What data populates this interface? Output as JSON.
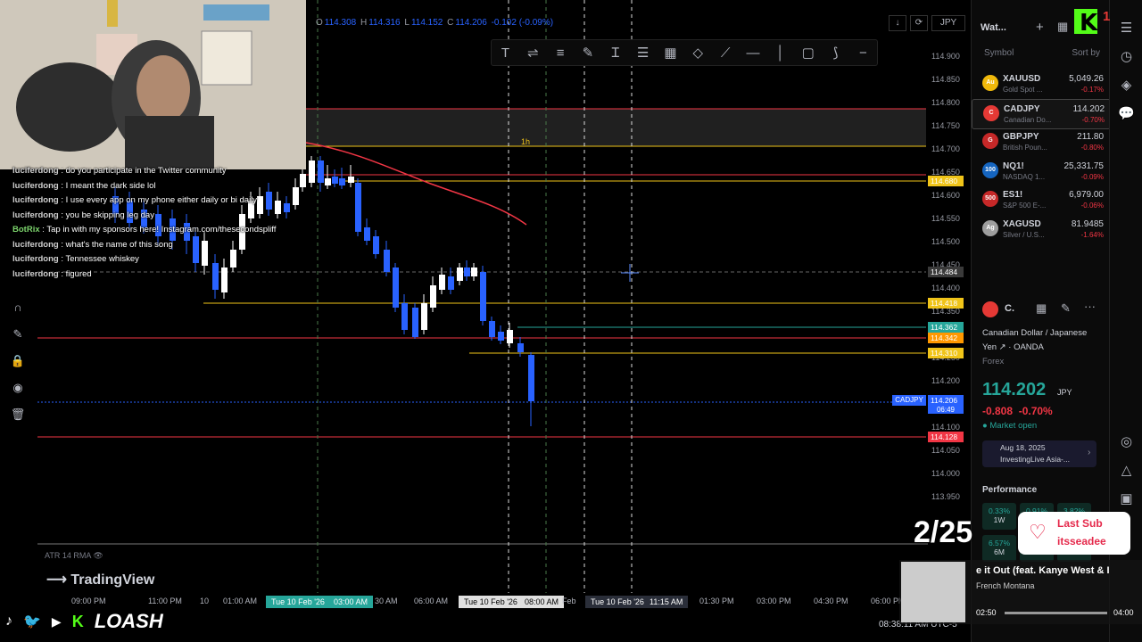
{
  "chart": {
    "ohlc": {
      "open_label": "O",
      "open": "114.308",
      "high_label": "H",
      "high": "114.316",
      "low_label": "L",
      "low": "114.152",
      "close_label": "C",
      "close": "114.206",
      "change": "-0.102 (-0.09%)"
    },
    "currency": "JPY",
    "interval_label": "1h",
    "indicator": "ATR 14 RMA",
    "watermark": "TradingView",
    "symbol_tag": "CADJPY",
    "countdown": "06:49",
    "price_axis": [
      "114.900",
      "114.850",
      "114.800",
      "114.750",
      "114.700",
      "114.650",
      "114.600",
      "114.550",
      "114.500",
      "114.450",
      "114.400",
      "114.350",
      "114.300",
      "114.250",
      "114.200",
      "114.150",
      "114.100",
      "114.050",
      "114.000",
      "113.950"
    ],
    "price_tags": [
      {
        "value": "114.680",
        "color": "#f0c419"
      },
      {
        "value": "114.484",
        "color": "#3a3a3a"
      },
      {
        "value": "114.418",
        "color": "#f0c419"
      },
      {
        "value": "114.362",
        "color": "#26a69a"
      },
      {
        "value": "114.342",
        "color": "#ff9800"
      },
      {
        "value": "114.310",
        "color": "#f0c419"
      },
      {
        "value": "114.206",
        "color": "#2962ff"
      },
      {
        "value": "114.128",
        "color": "#f23645"
      }
    ],
    "time_axis": [
      "09:00 PM",
      "11:00 PM",
      "10",
      "01:00 AM",
      "Tue 10 Feb '26",
      "03:00 AM",
      "30 AM",
      "06:00 AM",
      "Tue 10 Feb '26",
      "08:00 AM",
      "Feb",
      "Tue 10 Feb '26",
      "11:15 AM",
      "01:30 PM",
      "03:00 PM",
      "04:30 PM",
      "06:00 PM"
    ],
    "clock": "08:38:11 AM UTC-5",
    "toolbar_icons": [
      "text-icon",
      "align-icon",
      "align2-icon",
      "pen-icon",
      "text-cursor-icon",
      "lines-icon",
      "grid-icon",
      "shape-icon",
      "ray-icon",
      "horizontal-line-icon",
      "vertical-line-icon",
      "rect-icon",
      "brush-icon",
      "minus-icon"
    ]
  },
  "chat": [
    {
      "user": "luciferdong",
      "msg": "do you participate in the Twitter community"
    },
    {
      "user": "luciferdong",
      "msg": "I meant the dark side lol"
    },
    {
      "user": "luciferdong",
      "msg": "I use every app on my phone either daily or bi daily"
    },
    {
      "user": "luciferdong",
      "msg": "you be skipping leg day"
    },
    {
      "user": "BotRix",
      "msg": "Tap in with my sponsors here! Instagram.com/thesecondspliff",
      "bot": true
    },
    {
      "user": "luciferdong",
      "msg": "what's the name of this song"
    },
    {
      "user": "luciferdong",
      "msg": "Tennessee whiskey"
    },
    {
      "user": "luciferdong",
      "msg": "figured"
    }
  ],
  "watchlist": {
    "title": "Wat...",
    "col_symbol": "Symbol",
    "col_sort": "Sort by",
    "items": [
      {
        "sym": "XAUUSD",
        "desc": "Gold Spot ...",
        "price": "5,049.26",
        "chg": "-0.17%",
        "icon_color": "#f0b90b",
        "icon": "Au"
      },
      {
        "sym": "CADJPY",
        "desc": "Canadian Do...",
        "price": "114.202",
        "chg": "-0.70%",
        "icon_color": "#e53935",
        "icon": "C",
        "selected": true
      },
      {
        "sym": "GBPJPY",
        "desc": "British Poun...",
        "price": "211.80",
        "chg": "-0.80%",
        "icon_color": "#c62828",
        "icon": "G"
      },
      {
        "sym": "NQ1!",
        "desc": "NASDAQ 1...",
        "price": "25,331.75",
        "chg": "-0.09%",
        "icon_color": "#1565c0",
        "icon": "100"
      },
      {
        "sym": "ES1!",
        "desc": "S&P 500 E-...",
        "price": "6,979.00",
        "chg": "-0.06%",
        "icon_color": "#c62828",
        "icon": "500"
      },
      {
        "sym": "XAGUSD",
        "desc": "Silver / U.S...",
        "price": "81.9485",
        "chg": "-1.64%",
        "icon_color": "#9e9e9e",
        "icon": "Ag"
      }
    ]
  },
  "detail": {
    "short": "C.",
    "name": "Canadian Dollar / Japanese Yen",
    "broker": "OANDA",
    "type": "Forex",
    "price": "114.202",
    "ccy": "JPY",
    "change": "-0.808",
    "change_pct": "-0.70%",
    "status": "Market open",
    "news_date": "Aug 18, 2025",
    "news_src": "InvestingLive Asia-...",
    "perf_title": "Performance",
    "perf": [
      {
        "v": "0.33%",
        "p": "1W"
      },
      {
        "v": "0.91%",
        "p": ""
      },
      {
        "v": "3.82%",
        "p": ""
      },
      {
        "v": "6.57%",
        "p": "6M"
      },
      {
        "v": "",
        "p": "YTD"
      },
      {
        "v": "",
        "p": ""
      }
    ]
  },
  "overlay": {
    "sub_count": "2/25",
    "sub_label1": "Last Sub",
    "sub_label2": "itsseadee",
    "song_title": "e it Out (feat. Kanye West & I",
    "song_artist": "French Montana",
    "time_cur": "02:50",
    "time_total": "04:00",
    "brand": "LOASH",
    "k_badge": "1"
  }
}
